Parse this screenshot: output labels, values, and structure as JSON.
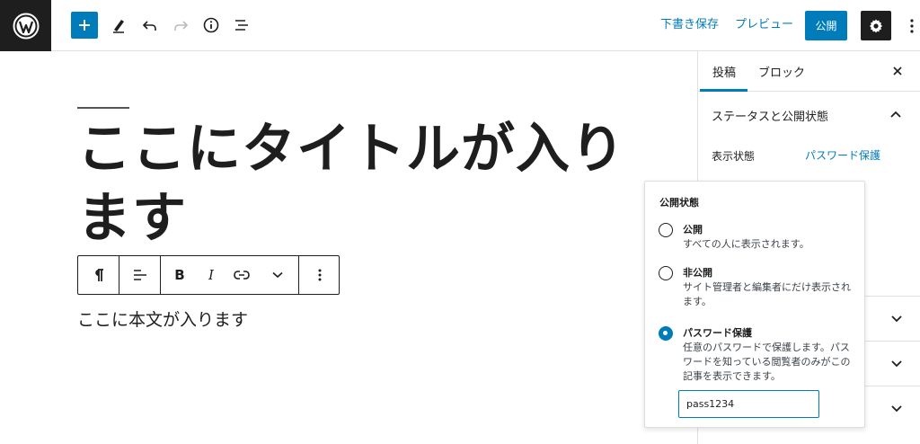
{
  "colors": {
    "accent": "#007cba",
    "dark": "#1e1e1e"
  },
  "header": {
    "save_draft": "下書き保存",
    "preview": "プレビュー",
    "publish": "公開",
    "icons": [
      "wordpress-logo",
      "plus-icon",
      "pencil-icon",
      "undo-icon",
      "redo-icon",
      "info-icon",
      "list-view-icon",
      "gear-icon",
      "more-vertical-icon"
    ]
  },
  "editor": {
    "title": "ここにタイトルが入ります",
    "body": "ここに本文が入ります",
    "block_toolbar": [
      "paragraph-icon",
      "align-icon",
      "bold-icon",
      "italic-icon",
      "link-icon",
      "chevron-down-icon",
      "more-vertical-icon"
    ],
    "bold_label": "B",
    "italic_label": "I"
  },
  "sidebar": {
    "tabs": [
      {
        "label": "投稿",
        "active": true
      },
      {
        "label": "ブロック",
        "active": false
      }
    ],
    "section_title": "ステータスと公開状態",
    "visibility_label": "表示状態",
    "visibility_value": "パスワード保護"
  },
  "popover": {
    "heading": "公開状態",
    "options": [
      {
        "label": "公開",
        "desc": "すべての人に表示されます。",
        "checked": false
      },
      {
        "label": "非公開",
        "desc": "サイト管理者と編集者にだけ表示されます。",
        "checked": false
      },
      {
        "label": "パスワード保護",
        "desc": "任意のパスワードで保護します。パスワードを知っている閲覧者のみがこの記事を表示できます。",
        "checked": true
      }
    ],
    "password_value": "pass1234"
  }
}
